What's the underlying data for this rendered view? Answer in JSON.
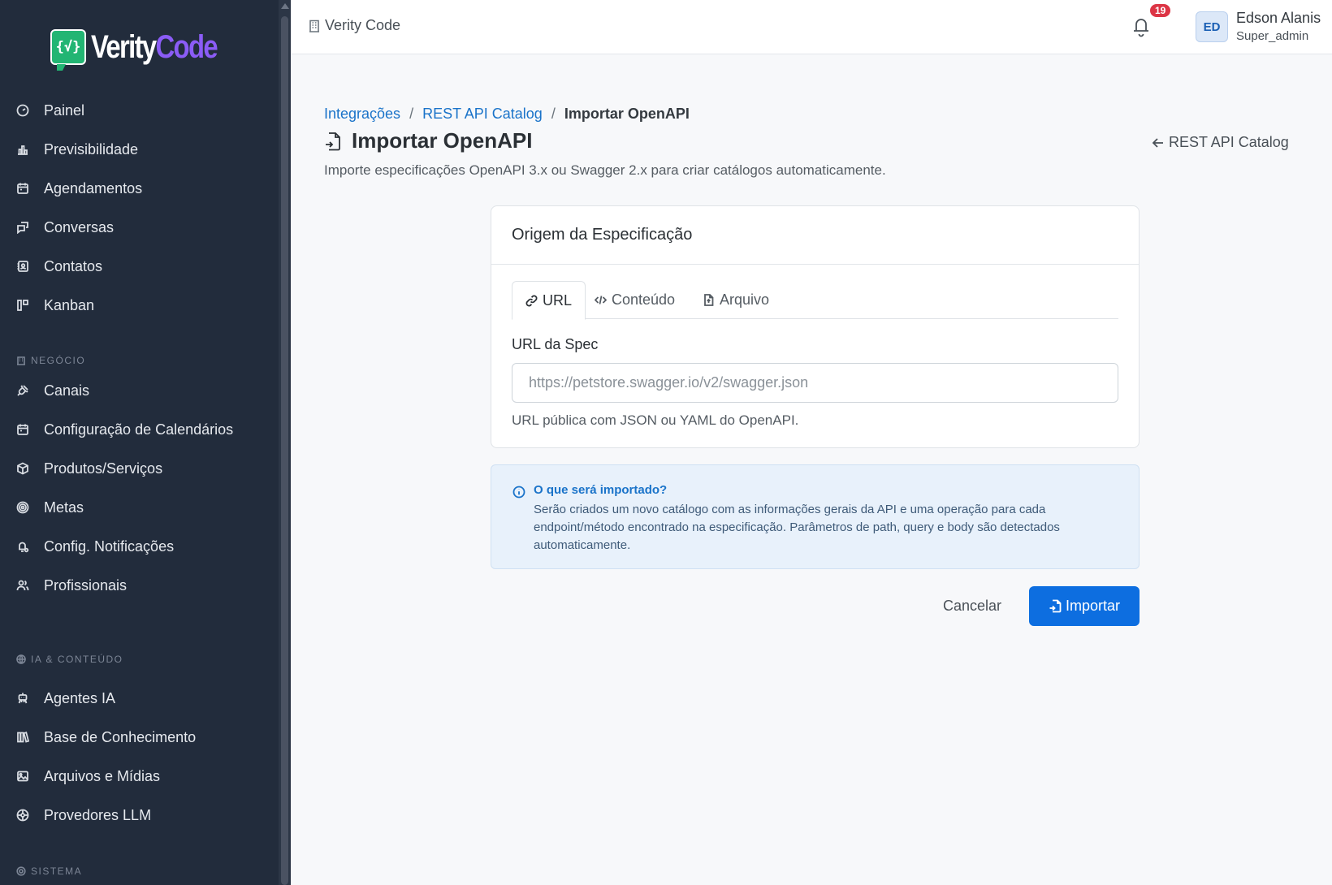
{
  "sidebar": {
    "logo": {
      "mark": "{√}",
      "word_white": "Verity",
      "word_purple": "Code"
    },
    "items": [
      {
        "label": "Painel",
        "icon": "gauge-icon"
      },
      {
        "label": "Previsibilidade",
        "icon": "bar-chart-icon"
      },
      {
        "label": "Agendamentos",
        "icon": "calendar-icon"
      },
      {
        "label": "Conversas",
        "icon": "chat-icon"
      },
      {
        "label": "Contatos",
        "icon": "contacts-icon"
      },
      {
        "label": "Kanban",
        "icon": "kanban-icon"
      }
    ],
    "section_business": "NEGÓCIO",
    "business_items": [
      {
        "label": "Canais",
        "icon": "plug-icon"
      },
      {
        "label": "Configuração de Calendários",
        "icon": "calendar-icon"
      },
      {
        "label": "Produtos/Serviços",
        "icon": "box-icon"
      },
      {
        "label": "Metas",
        "icon": "target-icon"
      },
      {
        "label": "Config. Notificações",
        "icon": "bell-gear-icon"
      },
      {
        "label": "Profissionais",
        "icon": "users-icon"
      }
    ],
    "section_ai": "IA & CONTEÚDO",
    "ai_items": [
      {
        "label": "Agentes IA",
        "icon": "robot-icon"
      },
      {
        "label": "Base de Conhecimento",
        "icon": "books-icon"
      },
      {
        "label": "Arquivos e Mídias",
        "icon": "image-icon"
      },
      {
        "label": "Provedores LLM",
        "icon": "network-icon"
      }
    ],
    "section_system": "SISTEMA"
  },
  "topbar": {
    "org_name": "Verity Code",
    "notification_count": "19",
    "avatar_initials": "ED",
    "user_name": "Edson Alanis",
    "user_role": "Super_admin"
  },
  "breadcrumb": {
    "items": [
      "Integrações",
      "REST API Catalog"
    ],
    "current": "Importar OpenAPI",
    "separator": "/"
  },
  "page": {
    "title": "Importar OpenAPI",
    "subtitle": "Importe especificações OpenAPI 3.x ou Swagger 2.x para criar catálogos automaticamente.",
    "back_label": "REST API Catalog"
  },
  "card": {
    "header": "Origem da Especificação",
    "tabs": [
      {
        "label": "URL",
        "icon": "link-icon",
        "active": true
      },
      {
        "label": "Conteúdo",
        "icon": "code-icon",
        "active": false
      },
      {
        "label": "Arquivo",
        "icon": "file-icon",
        "active": false
      }
    ],
    "field_label": "URL da Spec",
    "field_placeholder": "https://petstore.swagger.io/v2/swagger.json",
    "field_value": "",
    "help_text": "URL pública com JSON ou YAML do OpenAPI."
  },
  "info": {
    "title": "O que será importado?",
    "body": "Serão criados um novo catálogo com as informações gerais da API e uma operação para cada endpoint/método encontrado na especificação. Parâmetros de path, query e body são detectados automaticamente."
  },
  "actions": {
    "cancel": "Cancelar",
    "import": "Importar"
  },
  "colors": {
    "sidebar_bg": "#222c3c",
    "primary": "#0d6ee0",
    "link": "#1a73c9",
    "badge": "#dc3545",
    "logo_green": "#22b573",
    "logo_purple": "#8b5cf6"
  }
}
